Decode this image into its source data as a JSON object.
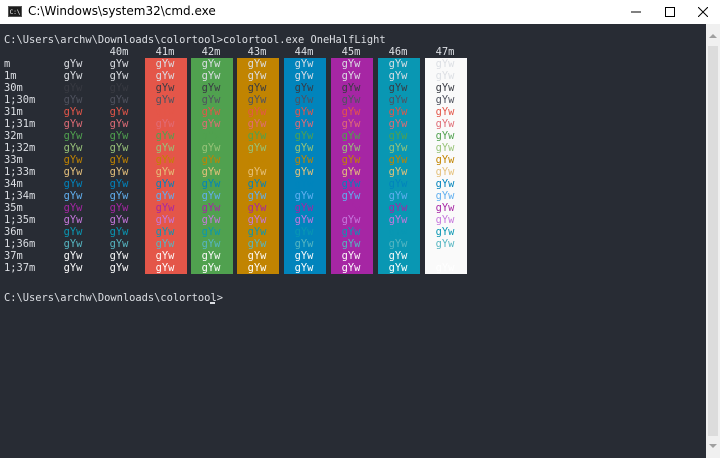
{
  "window": {
    "title": "C:\\Windows\\system32\\cmd.exe",
    "icon": "cmd-icon"
  },
  "terminal": {
    "prompt1": "C:\\Users\\archw\\Downloads\\colortool>colortool.exe OneHalfLight",
    "prompt2": "C:\\Users\\archw\\Downloads\\colortool>",
    "bg_headers": [
      "",
      "40m",
      "41m",
      "42m",
      "43m",
      "44m",
      "45m",
      "46m",
      "47m"
    ],
    "bg_colors": [
      "#282c34",
      "#282c34",
      "#e45649",
      "#50a14f",
      "#c18401",
      "#0184bc",
      "#a626a4",
      "#0997b3",
      "#fafafa"
    ],
    "sample": "gYw",
    "rows": [
      {
        "label": "m",
        "fg": "#dcdfe4"
      },
      {
        "label": "1m",
        "fg": "#dcdfe4"
      },
      {
        "label": "30m",
        "fg": "#383a42"
      },
      {
        "label": "1;30m",
        "fg": "#4f525e"
      },
      {
        "label": "31m",
        "fg": "#e45649"
      },
      {
        "label": "1;31m",
        "fg": "#e06c75"
      },
      {
        "label": "32m",
        "fg": "#50a14f"
      },
      {
        "label": "1;32m",
        "fg": "#98c379"
      },
      {
        "label": "33m",
        "fg": "#c18401"
      },
      {
        "label": "1;33m",
        "fg": "#e5c07b"
      },
      {
        "label": "34m",
        "fg": "#0184bc"
      },
      {
        "label": "1;34m",
        "fg": "#61afef"
      },
      {
        "label": "35m",
        "fg": "#a626a4"
      },
      {
        "label": "1;35m",
        "fg": "#c678dd"
      },
      {
        "label": "36m",
        "fg": "#0997b3"
      },
      {
        "label": "1;36m",
        "fg": "#56b6c2"
      },
      {
        "label": "37m",
        "fg": "#fafafa"
      },
      {
        "label": "1;37m",
        "fg": "#ffffff"
      }
    ]
  }
}
